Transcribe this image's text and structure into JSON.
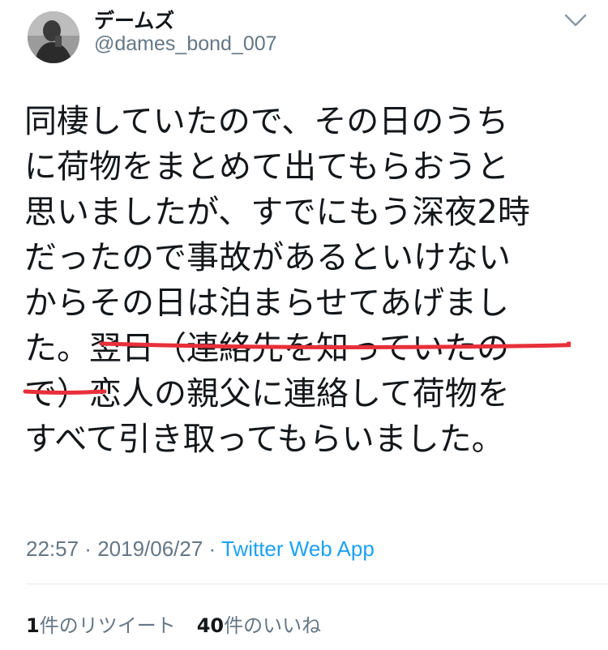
{
  "author": {
    "display_name": "デームズ",
    "handle": "@dames_bond_007"
  },
  "tweet": {
    "lines": [
      "同棲していたので、その日のうち",
      "に荷物をまとめて出てもらおうと",
      "思いましたが、すでにもう深夜2時",
      "だったので事故があるといけない",
      "からその日は泊まらせてあげまし",
      "た。翌日（連絡先を知っていたの",
      "で）恋人の親父に連絡して荷物を",
      "すべて引き取ってもらいました。"
    ],
    "highlight_color": "#e8303a"
  },
  "meta": {
    "time": "22:57",
    "sep1": " · ",
    "date": "2019/06/27",
    "sep2": " · ",
    "source": "Twitter Web App",
    "source_color": "#1da1f2"
  },
  "stats": {
    "retweet_count": "1",
    "retweet_label": "件のリツイート",
    "like_count": "40",
    "like_label": "件のいいね"
  },
  "icons": {
    "menu": "chevron-down-icon",
    "avatar": "profile-photo"
  }
}
